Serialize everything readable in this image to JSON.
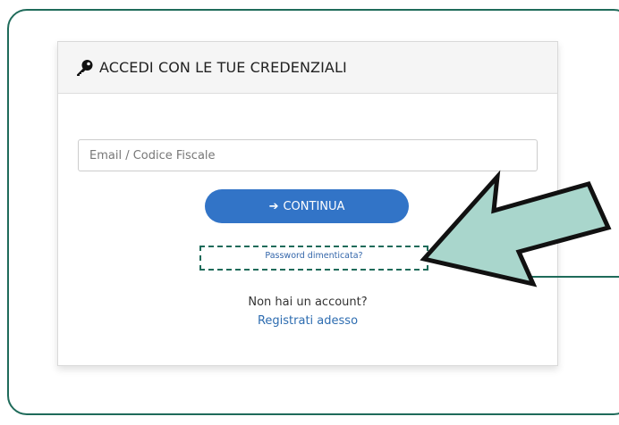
{
  "login": {
    "header_title": "ACCEDI CON LE TUE CREDENZIALI",
    "email_placeholder": "Email / Codice Fiscale",
    "continue_label": "CONTINUA",
    "continue_arrow": "➔",
    "forgot_password": "Password dimenticata?",
    "no_account": "Non hai un account?",
    "register": "Registrati adesso"
  },
  "colors": {
    "frame": "#1f6b5a",
    "button": "#3274c7",
    "arrow_fill": "#a9d6cc",
    "link": "#2d6cb0"
  },
  "icons": {
    "header": "key-icon",
    "button": "arrow-right-icon",
    "annotation": "pointer-arrow-icon"
  }
}
